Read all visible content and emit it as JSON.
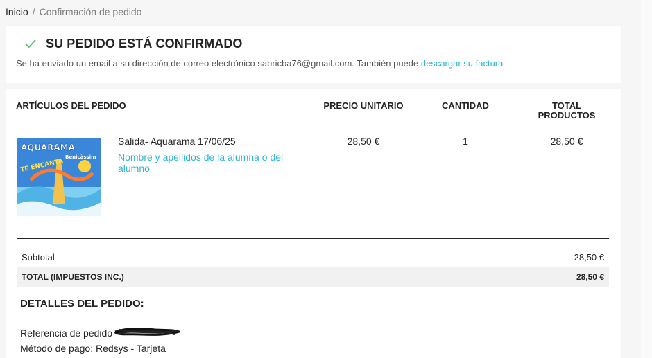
{
  "breadcrumb": {
    "home": "Inicio",
    "separator": "/",
    "current": "Confirmación de pedido"
  },
  "confirmation": {
    "icon": "check-icon",
    "title": "SU PEDIDO ESTÁ CONFIRMADO",
    "text": "Se ha enviado un email a su dirección de correo electrónico sabricba76@gmail.com. También puede ",
    "invoice_link": "descargar su factura"
  },
  "order": {
    "headers": {
      "items": "ARTÍCULOS DEL PEDIDO",
      "unit_price": "PRECIO UNITARIO",
      "quantity": "CANTIDAD",
      "total": "TOTAL PRODUCTOS"
    },
    "product": {
      "image_text": "AQUARAMA",
      "image_subtext": "Benicàssim",
      "image_slogan": "TE ENCANTA",
      "name": "Salida- Aquarama 17/06/25",
      "customization_link": "Nombre y apellidos de la alumna o del alumno",
      "unit_price": "28,50 €",
      "quantity": "1",
      "total": "28,50 €"
    },
    "subtotal_label": "Subtotal",
    "subtotal_value": "28,50 €",
    "total_label": "TOTAL (IMPUESTOS INC.)",
    "total_value": "28,50 €"
  },
  "details": {
    "title": "DETALLES DEL PEDIDO:",
    "reference_label": "Referencia de pedido",
    "payment": "Método de pago: Redsys - Tarjeta"
  },
  "colors": {
    "accent": "#2fb5d2",
    "check": "#4cbb6c",
    "text": "#232323"
  }
}
